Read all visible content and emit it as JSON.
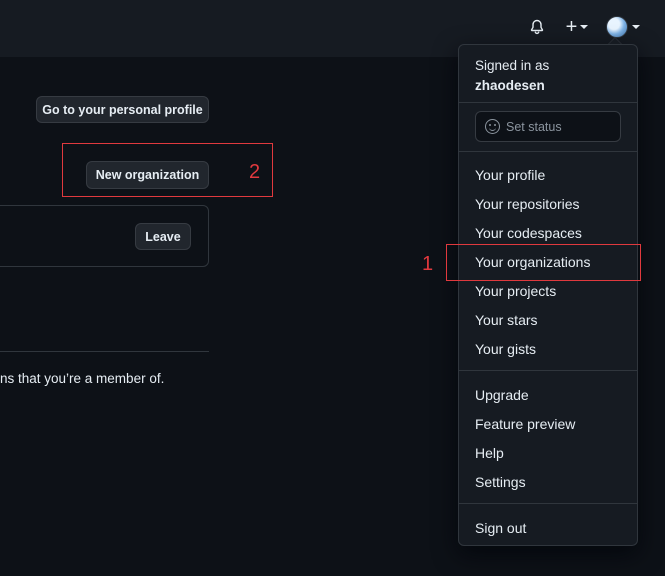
{
  "header": {
    "bell_icon": "bell-icon",
    "plus_label": "+",
    "avatar_icon": "avatar"
  },
  "main": {
    "profile_button": "Go to your personal profile",
    "new_org_button": "New organization",
    "leave_button": "Leave",
    "member_text": "ns that you’re a member of."
  },
  "annotations": {
    "label_1": "1",
    "label_2": "2",
    "color": "#e0393e"
  },
  "menu": {
    "signed_in_as": "Signed in as",
    "username": "zhaodesen",
    "status_placeholder": "Set status",
    "group1": [
      "Your profile",
      "Your repositories",
      "Your codespaces",
      "Your organizations",
      "Your projects",
      "Your stars",
      "Your gists"
    ],
    "group2": [
      "Upgrade",
      "Feature preview",
      "Help",
      "Settings"
    ],
    "sign_out": "Sign out"
  }
}
